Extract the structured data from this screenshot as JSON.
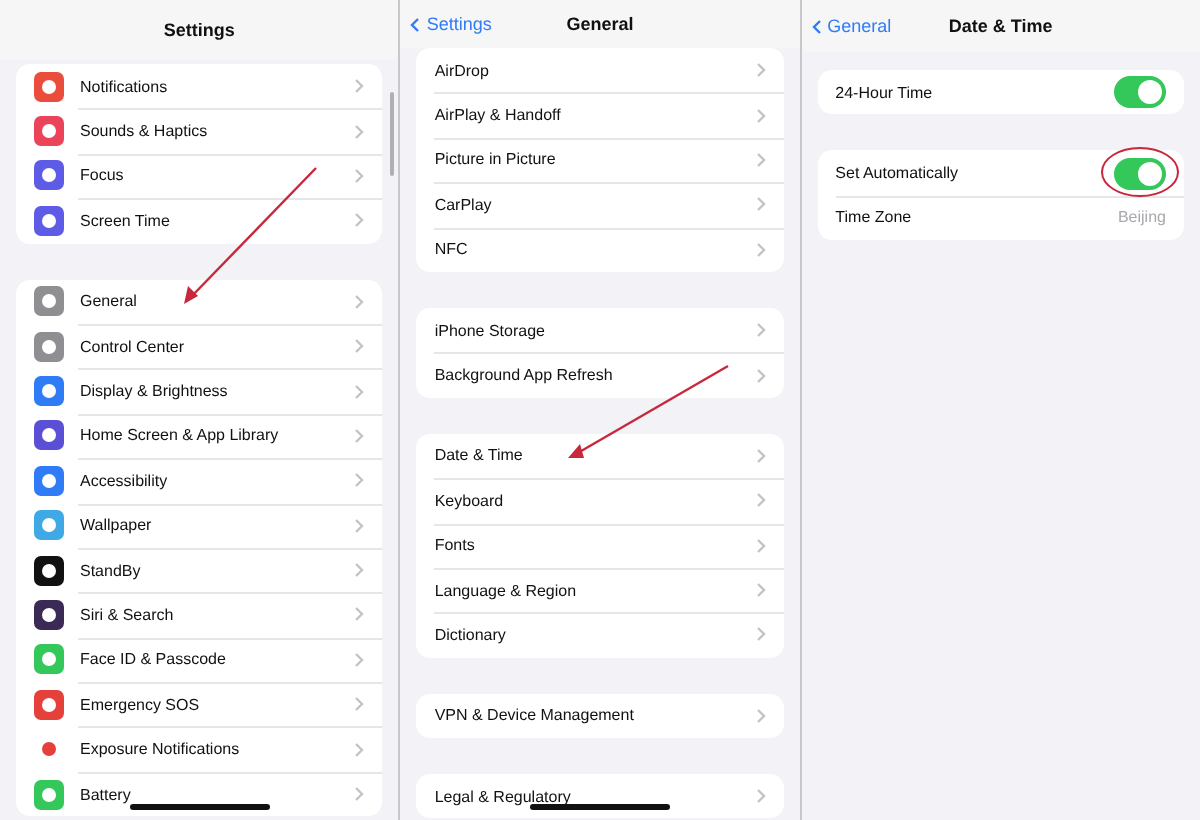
{
  "panels": [
    {
      "title": "Settings",
      "groups": [
        [
          {
            "label": "Notifications",
            "color": "#eb4d3d"
          },
          {
            "label": "Sounds & Haptics",
            "color": "#eb445a"
          },
          {
            "label": "Focus",
            "color": "#5e5ce6"
          },
          {
            "label": "Screen Time",
            "color": "#5e5ce6"
          }
        ],
        [
          {
            "label": "General",
            "color": "#8e8e93"
          },
          {
            "label": "Control Center",
            "color": "#8e8e93"
          },
          {
            "label": "Display & Brightness",
            "color": "#2f7cf6"
          },
          {
            "label": "Home Screen & App Library",
            "color": "#5b4fd6"
          },
          {
            "label": "Accessibility",
            "color": "#2f7cf6"
          },
          {
            "label": "Wallpaper",
            "color": "#3fa9e6"
          },
          {
            "label": "StandBy",
            "color": "#111111"
          },
          {
            "label": "Siri & Search",
            "color": "#3a2a55"
          },
          {
            "label": "Face ID & Passcode",
            "color": "#34c759"
          },
          {
            "label": "Emergency SOS",
            "color": "#e5403a"
          },
          {
            "label": "Exposure Notifications",
            "color": "#ffffff"
          },
          {
            "label": "Battery",
            "color": "#34c759"
          }
        ]
      ]
    },
    {
      "title": "General",
      "back": "Settings",
      "groups": [
        [
          {
            "label": "AirDrop"
          },
          {
            "label": "AirPlay & Handoff"
          },
          {
            "label": "Picture in Picture"
          },
          {
            "label": "CarPlay"
          },
          {
            "label": "NFC"
          }
        ],
        [
          {
            "label": "iPhone Storage"
          },
          {
            "label": "Background App Refresh"
          }
        ],
        [
          {
            "label": "Date & Time"
          },
          {
            "label": "Keyboard"
          },
          {
            "label": "Fonts"
          },
          {
            "label": "Language & Region"
          },
          {
            "label": "Dictionary"
          }
        ],
        [
          {
            "label": "VPN & Device Management"
          }
        ],
        [
          {
            "label": "Legal & Regulatory"
          }
        ]
      ]
    },
    {
      "title": "Date & Time",
      "back": "General",
      "groups": [
        [
          {
            "label": "24-Hour Time",
            "kind": "toggle",
            "on": true
          }
        ],
        [
          {
            "label": "Set Automatically",
            "kind": "toggle",
            "on": true
          },
          {
            "label": "Time Zone",
            "kind": "value",
            "value": "Beijing"
          }
        ]
      ]
    }
  ]
}
